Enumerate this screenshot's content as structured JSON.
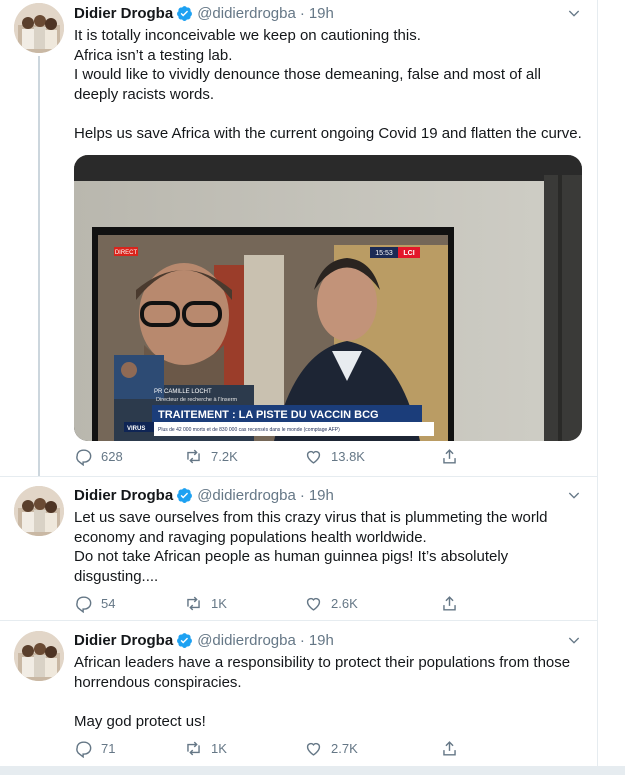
{
  "tweets": [
    {
      "author": "Didier Drogba",
      "handle": "@didierdrogba",
      "time": "19h",
      "lines": [
        "It is totally inconceivable we keep on cautioning this.",
        "Africa isn’t a testing lab.",
        "I would like to vividly denounce those demeaning, false and most of all deeply racists words.",
        "",
        "Helps us save Africa with the current ongoing Covid 19 and flatten the curve."
      ],
      "media": {
        "channel_tag": "DIRECT",
        "clock": "15:53",
        "channel": "LCI",
        "name_tag": "PR CAMILLE LOCHT",
        "role": "Directeur de recherche à l'Inserm",
        "headline": "TRAITEMENT : LA PISTE DU VACCIN BCG",
        "section": "VIRUS",
        "ticker": "Plus de 42 000 morts et de 830 000 cas recensés dans le monde (comptage AFP)"
      },
      "replies": "628",
      "retweets": "7.2K",
      "likes": "13.8K"
    },
    {
      "author": "Didier Drogba",
      "handle": "@didierdrogba",
      "time": "19h",
      "lines": [
        "Let us save ourselves from this crazy virus that is plummeting the world economy and ravaging populations health worldwide.",
        "Do not take African people as human guinnea pigs! It’s absolutely disgusting...."
      ],
      "replies": "54",
      "retweets": "1K",
      "likes": "2.6K"
    },
    {
      "author": "Didier Drogba",
      "handle": "@didierdrogba",
      "time": "19h",
      "lines": [
        "African leaders have a responsibility to protect their populations from those horrendous conspiracies.",
        "",
        "May god protect us!"
      ],
      "replies": "71",
      "retweets": "1K",
      "likes": "2.7K"
    }
  ],
  "colors": {
    "text": "#14171a",
    "secondary": "#657786",
    "verified": "#1da1f2",
    "divider": "#e6ecf0"
  },
  "icons": [
    "verified-badge-icon",
    "chevron-down-icon",
    "reply-icon",
    "retweet-icon",
    "like-icon",
    "share-icon"
  ]
}
